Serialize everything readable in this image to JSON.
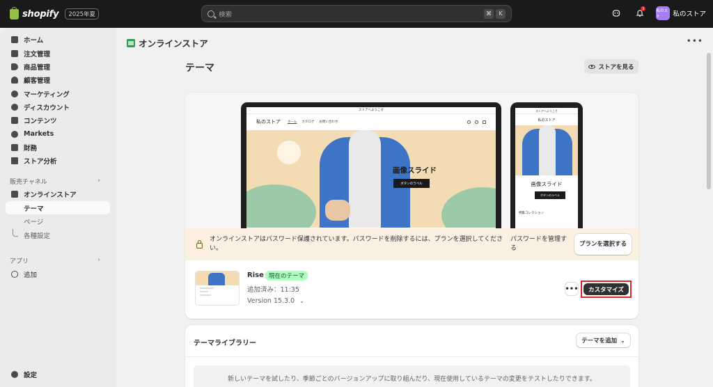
{
  "topbar": {
    "brand": "shopify",
    "edition": "2025年夏",
    "search_placeholder": "検索",
    "kbd": [
      "⌘",
      "K"
    ],
    "notification_count": "1",
    "avatar_text": "私のスト",
    "store_name": "私のストア"
  },
  "sidebar": {
    "items": [
      {
        "label": "ホーム",
        "icon": "home-icon"
      },
      {
        "label": "注文管理",
        "icon": "inbox-icon"
      },
      {
        "label": "商品管理",
        "icon": "tag-icon"
      },
      {
        "label": "顧客管理",
        "icon": "person-icon"
      },
      {
        "label": "マーケティング",
        "icon": "target-icon"
      },
      {
        "label": "ディスカウント",
        "icon": "discount-icon"
      },
      {
        "label": "コンテンツ",
        "icon": "content-icon"
      },
      {
        "label": "Markets",
        "icon": "globe-icon"
      },
      {
        "label": "財務",
        "icon": "bank-icon"
      },
      {
        "label": "ストア分析",
        "icon": "chart-bar-icon"
      }
    ],
    "sales_channels_label": "販売チャネル",
    "online_store_label": "オンラインストア",
    "sub_items": [
      "テーマ",
      "ページ",
      "各種設定"
    ],
    "apps_label": "アプリ",
    "add_label": "追加",
    "settings_label": "設定"
  },
  "main": {
    "page_title": "オンラインストア",
    "section_title": "テーマ",
    "view_store_label": "ストアを見る",
    "preview": {
      "announcement": "ストアへようこそ",
      "brand": "私のストア",
      "nav_links": [
        "ホーム",
        "カタログ",
        "お問い合わせ"
      ],
      "slide_title": "画像スライド",
      "slide_button": "ボタンのラベル",
      "featured_collection": "特集コレクション"
    },
    "banner": {
      "text": "オンラインストアはパスワード保護されています。パスワードを削除するには、プランを選択してください。",
      "link": "パスワードを管理する",
      "button": "プランを選択する"
    },
    "theme": {
      "name": "Rise",
      "badge": "現在のテーマ",
      "added": "追加済み：11:35",
      "version": "Version 15.3.0",
      "more_label": "•••",
      "customize_label": "カスタマイズ"
    },
    "library": {
      "title": "テーマライブラリー",
      "add_button": "テーマを追加",
      "empty_text": "新しいテーマを試したり、季節ごとのバージョンアップに取り組んだり、現在使用しているテーマの変更をテストしたりできます。"
    }
  }
}
